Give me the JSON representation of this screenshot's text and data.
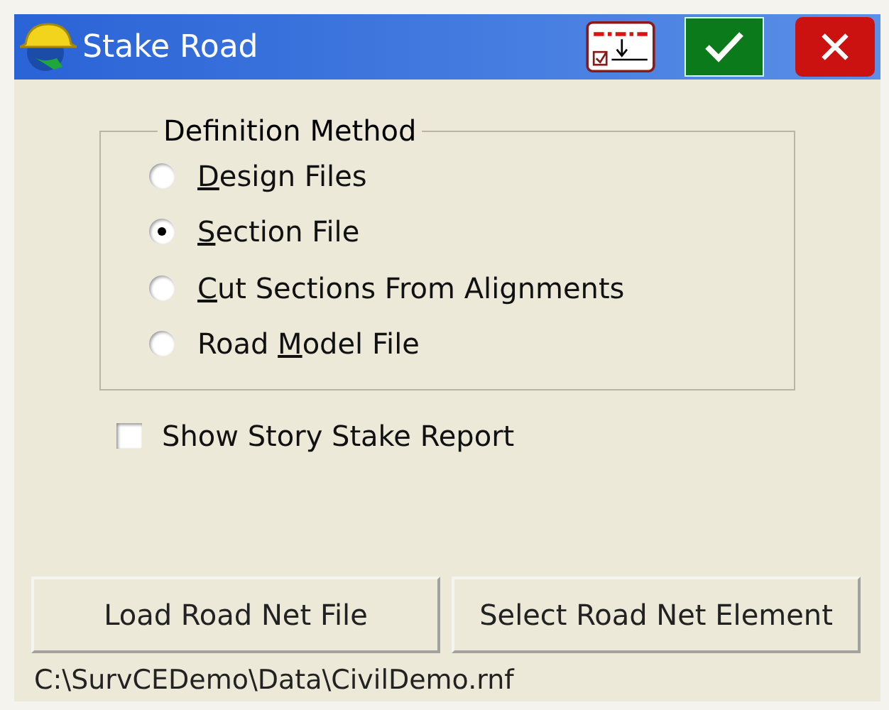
{
  "window": {
    "title": "Stake Road"
  },
  "definition_method": {
    "legend": "Definition Method",
    "options": [
      {
        "mnemonic": "D",
        "after": "esign Files",
        "selected": false
      },
      {
        "mnemonic": "S",
        "after": "ection File",
        "selected": true
      },
      {
        "mnemonic": "C",
        "after": "ut Sections From Alignments",
        "selected": false
      },
      {
        "before": "Road ",
        "mnemonic": "M",
        "after": "odel File",
        "selected": false
      }
    ]
  },
  "show_report": {
    "label": "Show Story Stake Report",
    "checked": false
  },
  "buttons": [
    "Load Road Net File",
    "Select Road Net Element"
  ],
  "file_path": "C:\\SurvCEDemo\\Data\\CivilDemo.rnf"
}
